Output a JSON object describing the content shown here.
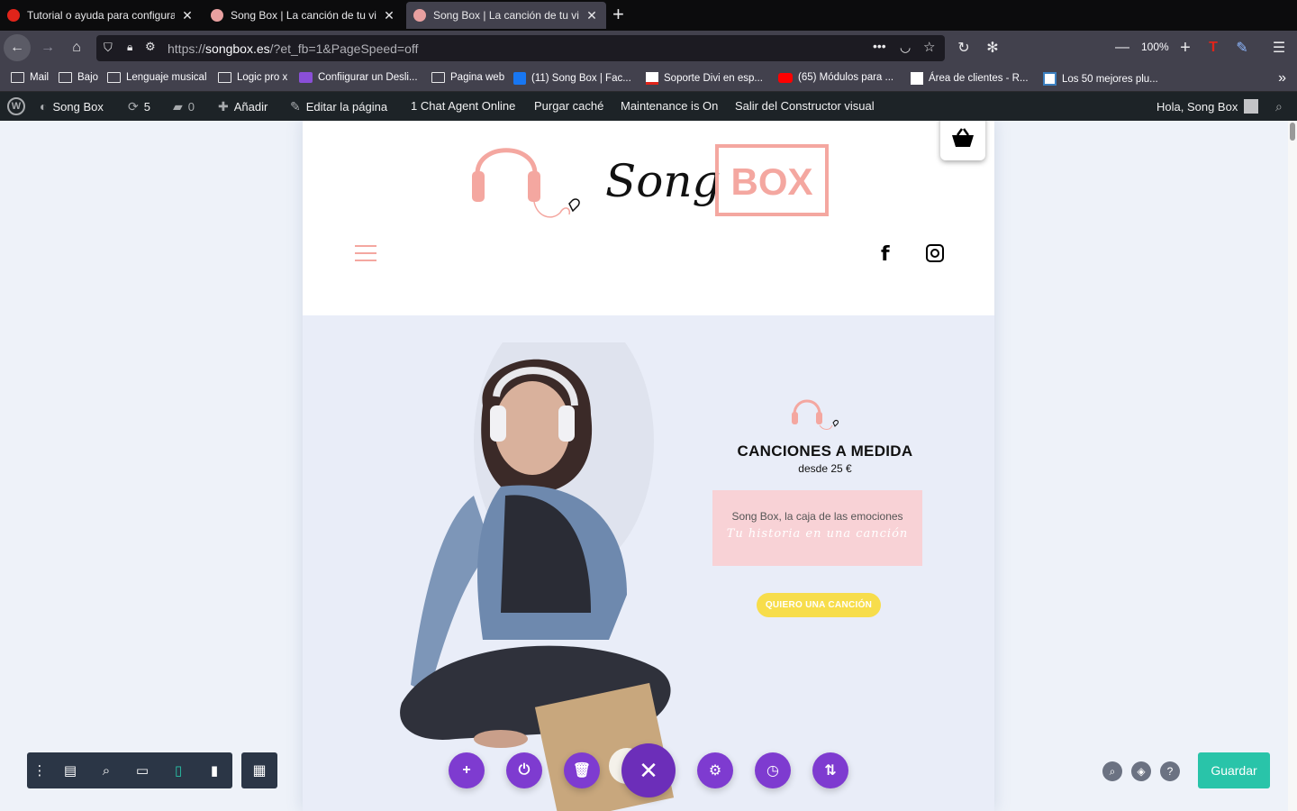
{
  "browser": {
    "tabs": [
      {
        "title": "Tutorial o ayuda para configurar",
        "favicon_color": "#e0241a",
        "active": false
      },
      {
        "title": "Song Box | La canción de tu vida",
        "favicon_color": "#e8a0a0",
        "active": false
      },
      {
        "title": "Song Box | La canción de tu vida",
        "favicon_color": "#e8a0a0",
        "active": true
      }
    ],
    "url_scheme": "https://",
    "url_host": "songbox.es",
    "url_path": "/?et_fb=1&PageSpeed=off",
    "zoom": "100%",
    "bookmarks": [
      {
        "label": "Mail",
        "icon": "folder-icon"
      },
      {
        "label": "Bajo",
        "icon": "folder-icon"
      },
      {
        "label": "Lenguaje musical",
        "icon": "folder-icon"
      },
      {
        "label": "Logic pro x",
        "icon": "folder-icon"
      },
      {
        "label": "Confiigurar un Desli...",
        "icon": "plugin-icon"
      },
      {
        "label": "Pagina web",
        "icon": "folder-icon"
      },
      {
        "label": "(11) Song Box | Fac...",
        "icon": "facebook-icon"
      },
      {
        "label": "Soporte Divi en esp...",
        "icon": "divi-icon"
      },
      {
        "label": "(65) Módulos para ...",
        "icon": "youtube-icon"
      },
      {
        "label": "Área de clientes - R...",
        "icon": "hosting-icon"
      },
      {
        "label": "Los 50 mejores plu...",
        "icon": "wordpress-icon"
      }
    ]
  },
  "wpbar": {
    "site_name": "Song Box",
    "updates": "5",
    "comments": "0",
    "add": "Añadir",
    "edit_page": "Editar la página",
    "chat": "1 Chat Agent Online",
    "purge": "Purgar caché",
    "maintenance": "Maintenance is On",
    "exit_builder": "Salir del Constructor visual",
    "greeting": "Hola, Song Box"
  },
  "site": {
    "logo_script": "Song",
    "logo_box": "BOX",
    "hero_title": "CANCIONES A MEDIDA",
    "hero_sub": "desde 25 €",
    "box_line1": "Song Box, la caja de las emociones",
    "box_line2": "Tu historia en una canción",
    "cta": "QUIERO UNA CANCIÓN",
    "brand_pink": "#f4a7a0",
    "cta_color": "#f7dd4b"
  },
  "divi": {
    "save": "Guardar",
    "accent": "#7e3bd0",
    "save_color": "#29c4a9"
  }
}
